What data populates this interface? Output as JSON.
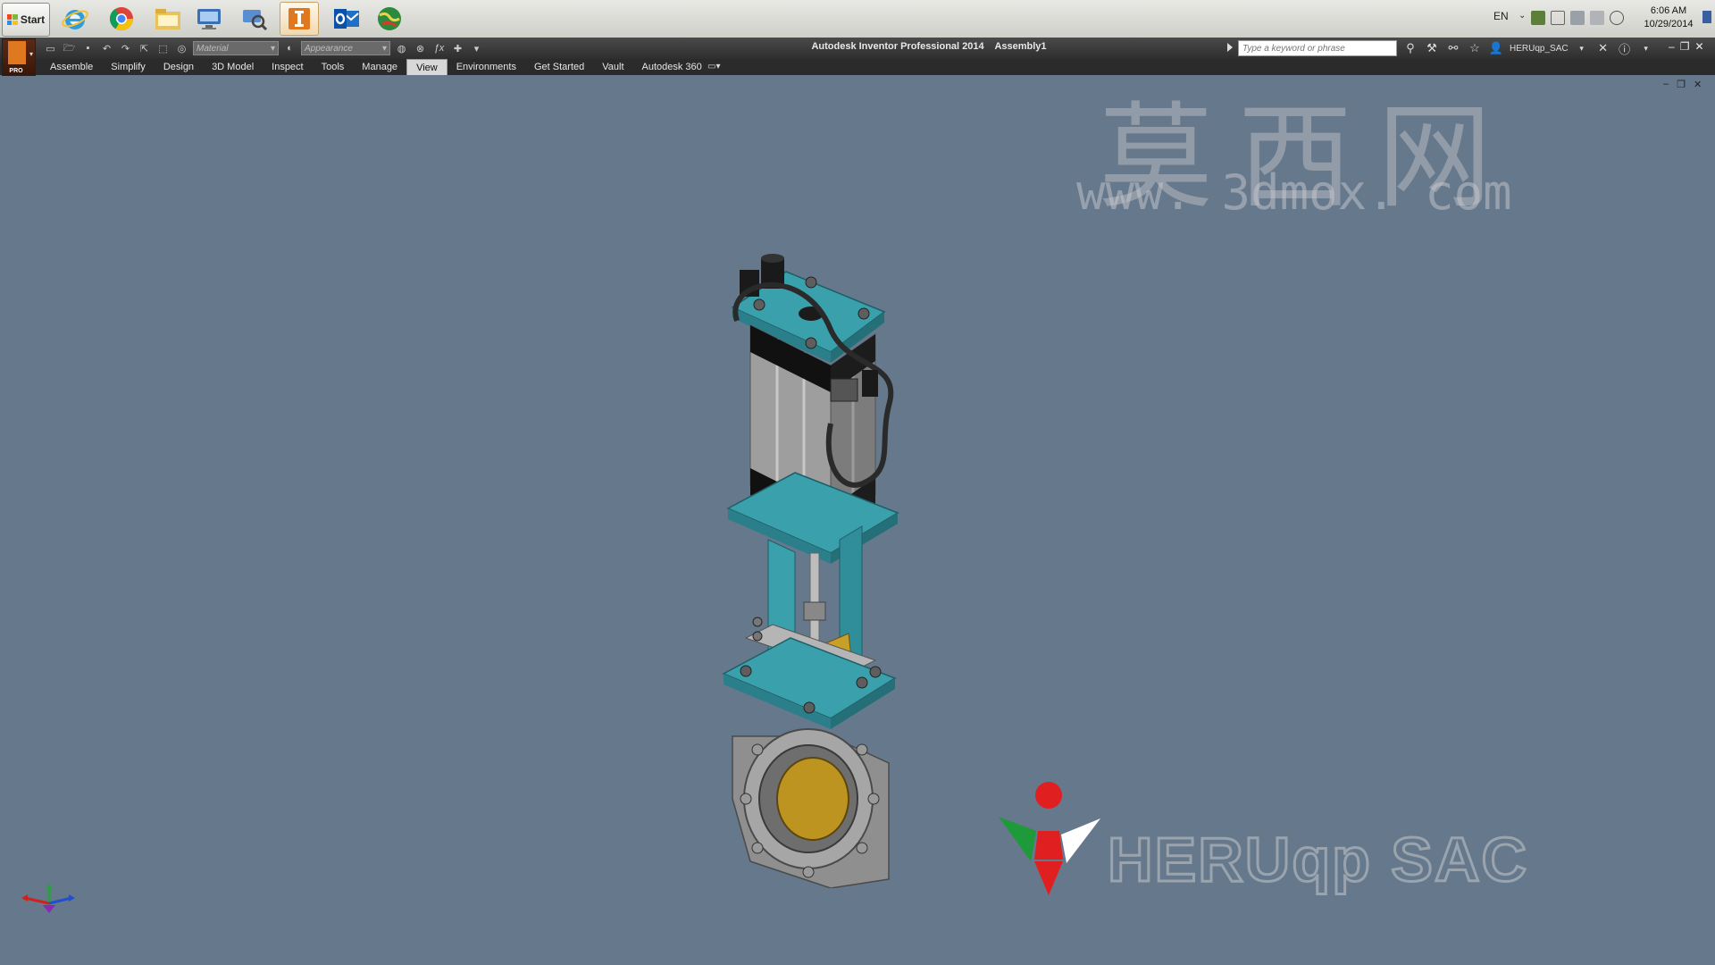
{
  "taskbar": {
    "start_label": "Start",
    "pinned": [
      {
        "name": "ie-icon"
      },
      {
        "name": "chrome-icon"
      },
      {
        "name": "explorer-icon"
      },
      {
        "name": "remote-desktop-icon"
      },
      {
        "name": "network-search-icon"
      },
      {
        "name": "inventor-icon",
        "active": true
      },
      {
        "name": "outlook-icon"
      },
      {
        "name": "globe-app-icon"
      }
    ],
    "language": "EN",
    "clock_time": "6:06 AM",
    "clock_date": "10/29/2014"
  },
  "app": {
    "title": "Autodesk Inventor Professional 2014",
    "document": "Assembly1",
    "app_badge": "PRO",
    "material_placeholder": "Material",
    "appearance_placeholder": "Appearance",
    "search_placeholder": "Type a keyword or phrase",
    "user": "HERUqp_SAC"
  },
  "ribbon": {
    "tabs": [
      "Assemble",
      "Simplify",
      "Design",
      "3D Model",
      "Inspect",
      "Tools",
      "Manage",
      "View",
      "Environments",
      "Get Started",
      "Vault",
      "Autodesk 360"
    ],
    "active_tab": "View"
  },
  "watermark": {
    "chinese": "莫西网",
    "url": "www. 3dmox. com"
  },
  "logo": {
    "text": "HERUqp SAC",
    "colors": {
      "red": "#e02020",
      "green": "#1e9a3a",
      "white": "#ffffff"
    }
  },
  "colors": {
    "viewport_bg": "#66788c",
    "teal": "#3aa0ac",
    "inventor_orange": "#e07820"
  }
}
